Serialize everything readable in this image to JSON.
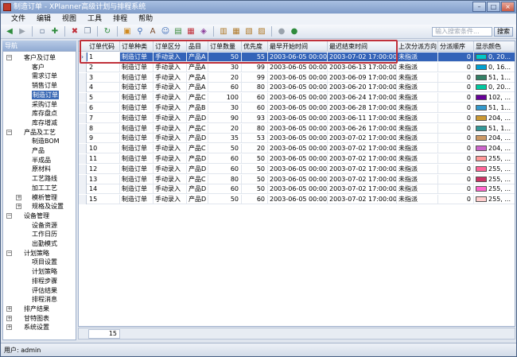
{
  "window": {
    "title": "制造订单 - XPlanner高级计划与排程系统"
  },
  "menu": [
    "文件",
    "编辑",
    "视图",
    "工具",
    "排程",
    "帮助"
  ],
  "toolbar": {
    "icons": [
      "back-icon",
      "forward-icon",
      "new-icon",
      "add-icon",
      "delete-icon",
      "copy-icon",
      "refresh-icon",
      "open-icon",
      "find-icon",
      "font-icon",
      "user-icon",
      "chart-icon",
      "image-icon",
      "eraser-icon",
      "grid-icon",
      "table-icon",
      "export-icon",
      "print-icon",
      "stop-icon",
      "run-icon"
    ],
    "search_placeholder": "输入搜索条件...",
    "search_button": "搜索"
  },
  "nav": {
    "title": "导航",
    "items": [
      {
        "label": "客户及订单",
        "level": 0,
        "expanded": true
      },
      {
        "label": "客户",
        "level": 1
      },
      {
        "label": "需求订单",
        "level": 1
      },
      {
        "label": "销售订单",
        "level": 1
      },
      {
        "label": "制造订单",
        "level": 1,
        "selected": true
      },
      {
        "label": "采购订单",
        "level": 1
      },
      {
        "label": "库存盘点",
        "level": 1
      },
      {
        "label": "库存增减",
        "level": 1
      },
      {
        "label": "产品及工艺",
        "level": 0,
        "expanded": true
      },
      {
        "label": "制造BOM",
        "level": 1
      },
      {
        "label": "产品",
        "level": 1
      },
      {
        "label": "半成品",
        "level": 1
      },
      {
        "label": "原材料",
        "level": 1
      },
      {
        "label": "工艺路线",
        "level": 1
      },
      {
        "label": "加工工艺",
        "level": 1
      },
      {
        "label": "模析管理",
        "level": 1,
        "expandable": true
      },
      {
        "label": "规格及设置",
        "level": 1,
        "expandable": true
      },
      {
        "label": "设备管理",
        "level": 0,
        "expanded": true
      },
      {
        "label": "设备资源",
        "level": 1
      },
      {
        "label": "工作日历",
        "level": 1
      },
      {
        "label": "出勤模式",
        "level": 1
      },
      {
        "label": "计划策略",
        "level": 0,
        "expanded": true
      },
      {
        "label": "项目设置",
        "level": 1
      },
      {
        "label": "计划策略",
        "level": 1
      },
      {
        "label": "排程步骤",
        "level": 1
      },
      {
        "label": "评估结果",
        "level": 1
      },
      {
        "label": "排程消息",
        "level": 1
      },
      {
        "label": "排产结果",
        "level": 0,
        "expandable": true
      },
      {
        "label": "甘特图表",
        "level": 0,
        "expandable": true
      },
      {
        "label": "系统设置",
        "level": 0,
        "expandable": true
      }
    ]
  },
  "table": {
    "columns": [
      "订单代码",
      "订单种类",
      "订单区分",
      "品目",
      "订单数量",
      "优先度",
      "最早开始时间",
      "最迟结束时间",
      "上次分派方向",
      "分派顺序",
      "显示颜色"
    ],
    "rows": [
      [
        "1",
        "制造订单",
        "手动录入",
        "产品A",
        "50",
        "55",
        "2003-06-05 00:00...",
        "2003-07-02 17:00:00",
        "未指派",
        "0",
        "0, 20..."
      ],
      [
        "2",
        "制造订单",
        "手动录入",
        "产品A",
        "30",
        "99",
        "2003-06-05 00:00...",
        "2003-06-13 17:00:00",
        "未指派",
        "0",
        "0, 16..."
      ],
      [
        "3",
        "制造订单",
        "手动录入",
        "产品A",
        "20",
        "99",
        "2003-06-05 00:00...",
        "2003-06-09 17:00:00",
        "未指派",
        "0",
        "51, 1..."
      ],
      [
        "4",
        "制造订单",
        "手动录入",
        "产品A",
        "60",
        "80",
        "2003-06-05 00:00...",
        "2003-06-20 17:00:00",
        "未指派",
        "0",
        "0, 20..."
      ],
      [
        "5",
        "制造订单",
        "手动录入",
        "产品C",
        "100",
        "60",
        "2003-06-05 00:00...",
        "2003-06-24 17:00:00",
        "未指派",
        "0",
        "102, ..."
      ],
      [
        "6",
        "制造订单",
        "手动录入",
        "产品B",
        "30",
        "60",
        "2003-06-05 00:00...",
        "2003-06-28 17:00:00",
        "未指派",
        "0",
        "51, 1..."
      ],
      [
        "7",
        "制造订单",
        "手动录入",
        "产品D",
        "90",
        "93",
        "2003-06-05 00:00...",
        "2003-06-11 17:00:00",
        "未指派",
        "0",
        "204, ..."
      ],
      [
        "8",
        "制造订单",
        "手动录入",
        "产品C",
        "20",
        "80",
        "2003-06-05 00:00...",
        "2003-06-26 17:00:00",
        "未指派",
        "0",
        "51, 1..."
      ],
      [
        "9",
        "制造订单",
        "手动录入",
        "产品D",
        "35",
        "53",
        "2003-06-05 00:00...",
        "2003-07-02 17:00:00",
        "未指派",
        "0",
        "204, ..."
      ],
      [
        "10",
        "制造订单",
        "手动录入",
        "产品C",
        "50",
        "20",
        "2003-06-05 00:00...",
        "2003-07-02 17:00:00",
        "未指派",
        "0",
        "204, ..."
      ],
      [
        "11",
        "制造订单",
        "手动录入",
        "产品D",
        "60",
        "50",
        "2003-06-05 00:00...",
        "2003-07-02 17:00:00",
        "未指派",
        "0",
        "255, ..."
      ],
      [
        "12",
        "制造订单",
        "手动录入",
        "产品D",
        "60",
        "50",
        "2003-06-05 00:00...",
        "2003-07-02 17:00:00",
        "未指派",
        "0",
        "255, ..."
      ],
      [
        "13",
        "制造订单",
        "手动录入",
        "产品C",
        "80",
        "50",
        "2003-06-05 00:00...",
        "2003-07-02 17:00:00",
        "未指派",
        "0",
        "255, ..."
      ],
      [
        "14",
        "制造订单",
        "手动录入",
        "产品D",
        "60",
        "50",
        "2003-06-05 00:00...",
        "2003-07-02 17:00:00",
        "未指派",
        "0",
        "255, ..."
      ],
      [
        "15",
        "制造订单",
        "手动录入",
        "产品D",
        "50",
        "60",
        "2003-06-05 00:00...",
        "2003-07-02 17:00:00",
        "未指派",
        "0",
        "255, ..."
      ]
    ],
    "swatches": [
      "#00c8c8",
      "#00a0d0",
      "#338066",
      "#00c8a0",
      "#660099",
      "#3399cc",
      "#cc9933",
      "#339999",
      "#cc9966",
      "#cc66cc",
      "#ff9999",
      "#ff6699",
      "#cc3366",
      "#ff66cc",
      "#ffcccc"
    ],
    "footer_count": "15"
  },
  "statusbar": {
    "text": "用户: admin"
  }
}
